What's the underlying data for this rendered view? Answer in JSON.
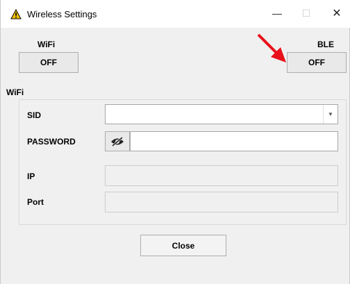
{
  "window": {
    "title": "Wireless Settings",
    "controls": {
      "minimize": "—",
      "maximize": "☐",
      "close": "✕"
    }
  },
  "wifi_toggle": {
    "label": "WiFi",
    "button": "OFF"
  },
  "ble_toggle": {
    "label": "BLE",
    "button": "OFF"
  },
  "wifi_section": {
    "title": "WiFi",
    "sid": {
      "label": "SID",
      "value": ""
    },
    "password": {
      "label": "PASSWORD",
      "value": ""
    },
    "ip": {
      "label": "IP",
      "value": ""
    },
    "port": {
      "label": "Port",
      "value": ""
    }
  },
  "footer": {
    "close_label": "Close"
  },
  "icons": {
    "app": "warning-triangle-icon",
    "eye": "eye-slash-icon",
    "dropdown": "chevron-down-icon",
    "annotation": "red-arrow-icon"
  },
  "colors": {
    "accent_arrow": "#e8111a",
    "warning_yellow": "#f2c200"
  }
}
